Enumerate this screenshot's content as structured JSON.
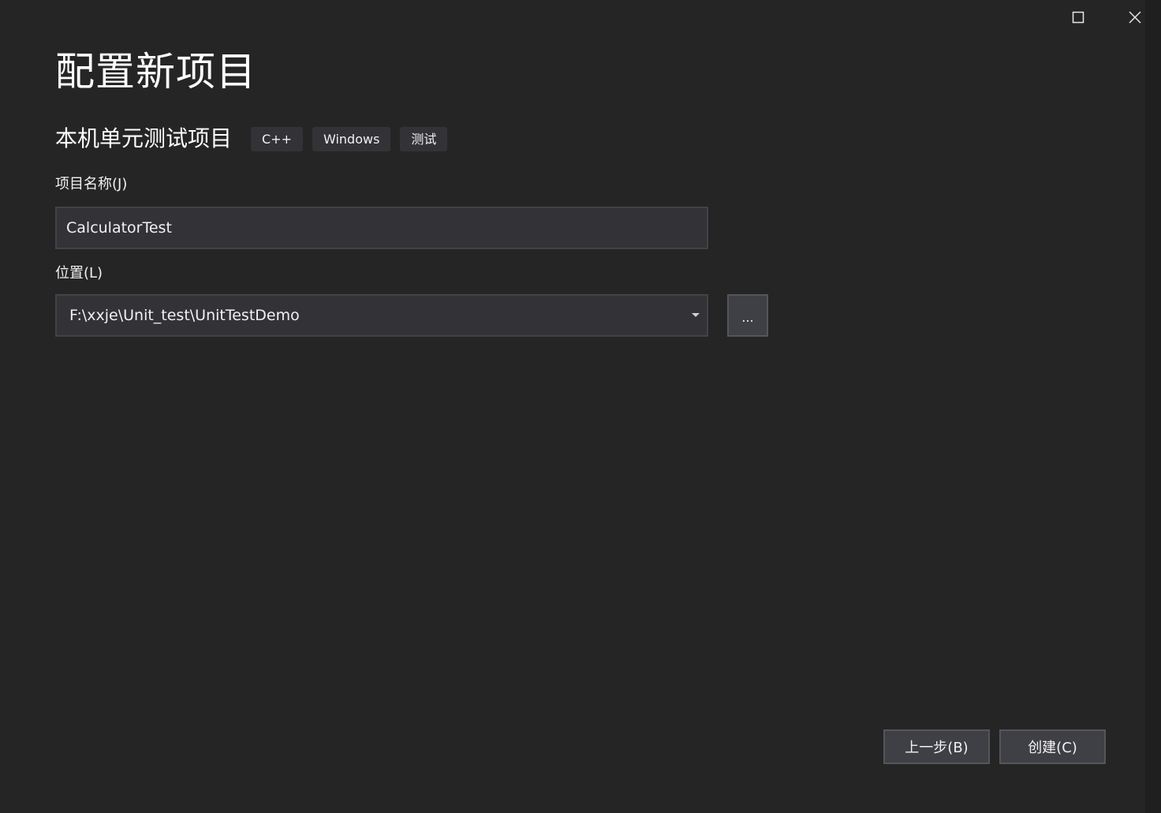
{
  "window": {
    "maximize_icon": "maximize-icon",
    "close_icon": "close-icon"
  },
  "header": {
    "title": "配置新项目"
  },
  "template": {
    "name": "本机单元测试项目",
    "tags": [
      "C++",
      "Windows",
      "测试"
    ]
  },
  "form": {
    "project_name_label": "项目名称(J)",
    "project_name_value": "CalculatorTest",
    "location_label": "位置(L)",
    "location_value": "F:\\xxje\\Unit_test\\UnitTestDemo",
    "browse_label": "..."
  },
  "footer": {
    "back_label": "上一步(B)",
    "create_label": "创建(C)"
  },
  "colors": {
    "background": "#252526",
    "input_background": "#333337",
    "button_background": "#3f3f46",
    "text": "#f1f1f1"
  }
}
